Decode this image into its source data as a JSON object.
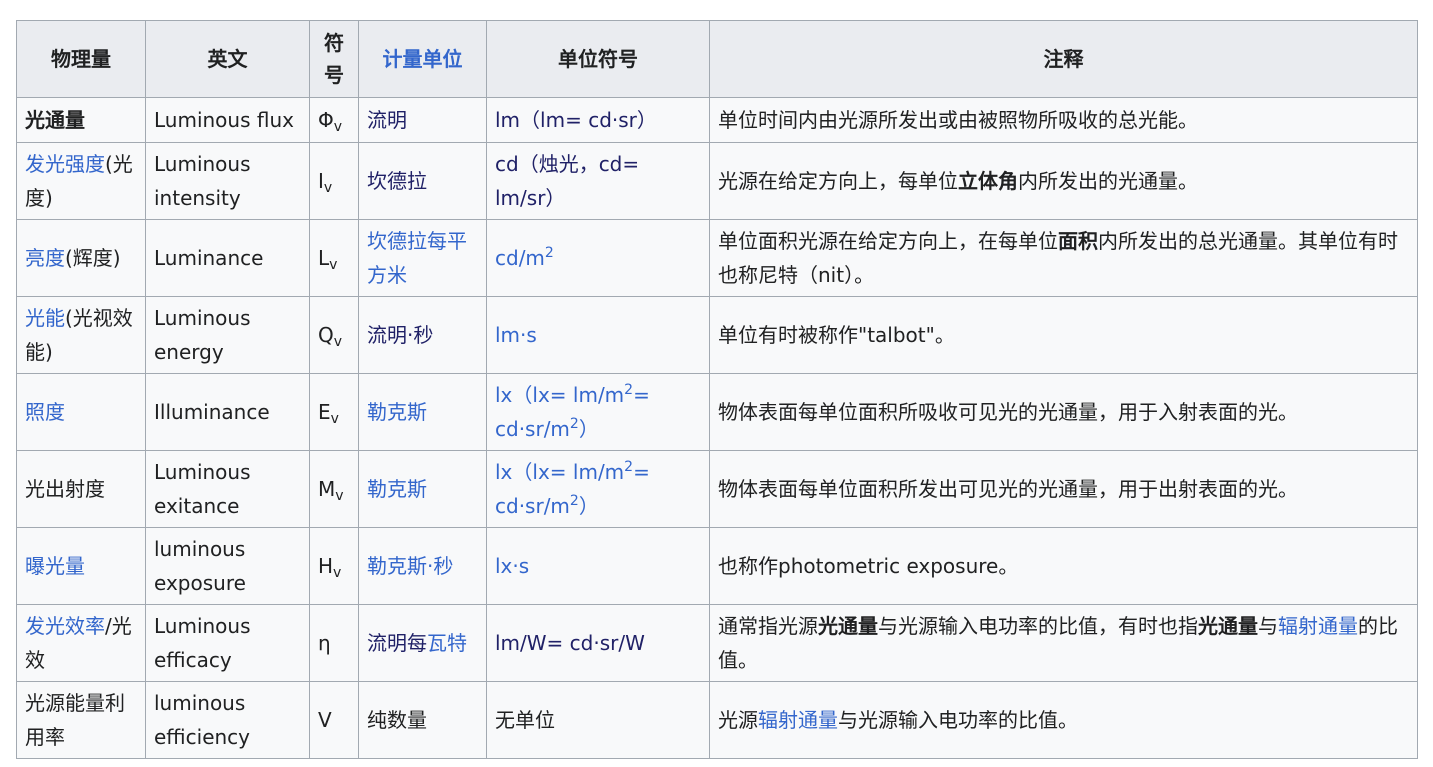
{
  "headers": {
    "quantity": "物理量",
    "english": "英文",
    "symbol": "符号",
    "unit": "计量单位",
    "unit_symbol": "单位符号",
    "notes": "注释"
  },
  "rows": [
    {
      "q": "光通量",
      "q_extra": "",
      "en": "Luminous flux",
      "sym": "Φ",
      "sub": "v",
      "unit_a": "流明",
      "unit_b": "",
      "us_a": "lm（lm= cd·sr）",
      "us_sup1": "",
      "us_b": "",
      "us_sup2": "",
      "us_c": "",
      "note_a": "单位时间内由光源所发出或由被照物所吸收的总光能。",
      "note_b": "",
      "note_c": "",
      "note_d": "",
      "note_e": "",
      "note_f": "",
      "note_g": ""
    },
    {
      "q": "发光强度",
      "q_extra": "(光度)",
      "en": "Luminous intensity",
      "sym": "I",
      "sub": "v",
      "unit_a": "坎德拉",
      "unit_b": "",
      "us_a": "cd（烛光，cd= lm/sr）",
      "us_sup1": "",
      "us_b": "",
      "us_sup2": "",
      "us_c": "",
      "note_a": "光源在给定方向上，每单位",
      "note_b": "立体角",
      "note_c": "内所发出的光通量。",
      "note_d": "",
      "note_e": "",
      "note_f": "",
      "note_g": ""
    },
    {
      "q": "亮度",
      "q_extra": "(辉度)",
      "en": "Luminance",
      "sym": "L",
      "sub": "v",
      "unit_a": "坎德拉每平方米",
      "unit_b": "",
      "us_a": "cd/m",
      "us_sup1": "2",
      "us_b": "",
      "us_sup2": "",
      "us_c": "",
      "note_a": "单位面积光源在给定方向上，在每单位",
      "note_b": "面积",
      "note_c": "内所发出的总光通量。其单位有时也称尼特（nit）。",
      "note_d": "",
      "note_e": "",
      "note_f": "",
      "note_g": ""
    },
    {
      "q": "光能",
      "q_extra": "(光视效能)",
      "en": "Luminous energy",
      "sym": "Q",
      "sub": "v",
      "unit_a": "流明·秒",
      "unit_b": "",
      "us_a": "lm·s",
      "us_sup1": "",
      "us_b": "",
      "us_sup2": "",
      "us_c": "",
      "note_a": "单位有时被称作\"talbot\"。",
      "note_b": "",
      "note_c": "",
      "note_d": "",
      "note_e": "",
      "note_f": "",
      "note_g": ""
    },
    {
      "q": "照度",
      "q_extra": "",
      "en": "Illuminance",
      "sym": "E",
      "sub": "v",
      "unit_a": "勒克斯",
      "unit_b": "",
      "us_a": "lx（lx= lm/m",
      "us_sup1": "2",
      "us_b": "= cd·sr/m",
      "us_sup2": "2",
      "us_c": "）",
      "note_a": "物体表面每单位面积所吸收可见光的光通量，用于入射表面的光。",
      "note_b": "",
      "note_c": "",
      "note_d": "",
      "note_e": "",
      "note_f": "",
      "note_g": ""
    },
    {
      "q": "光出射度",
      "q_extra": "",
      "en": "Luminous exitance",
      "sym": "M",
      "sub": "v",
      "unit_a": "勒克斯",
      "unit_b": "",
      "us_a": "lx（lx= lm/m",
      "us_sup1": "2",
      "us_b": "= cd·sr/m",
      "us_sup2": "2",
      "us_c": "）",
      "note_a": "物体表面每单位面积所发出可见光的光通量，用于出射表面的光。",
      "note_b": "",
      "note_c": "",
      "note_d": "",
      "note_e": "",
      "note_f": "",
      "note_g": ""
    },
    {
      "q": "曝光量",
      "q_extra": "",
      "en": "luminous exposure",
      "sym": "H",
      "sub": "v",
      "unit_a": "勒克斯·秒",
      "unit_b": "",
      "us_a": "lx·s",
      "us_sup1": "",
      "us_b": "",
      "us_sup2": "",
      "us_c": "",
      "note_a": "也称作photometric exposure。",
      "note_b": "",
      "note_c": "",
      "note_d": "",
      "note_e": "",
      "note_f": "",
      "note_g": ""
    },
    {
      "q": "发光效率",
      "q_extra": "/光效",
      "en": "Luminous efficacy",
      "sym": "η",
      "sub": "",
      "unit_a": "流明每",
      "unit_b": "瓦特",
      "us_a": "lm/W= cd·sr/W",
      "us_sup1": "",
      "us_b": "",
      "us_sup2": "",
      "us_c": "",
      "note_a": "通常指光源",
      "note_b": "光通量",
      "note_c": "与光源输入电功率的比值，有时也指",
      "note_d": "光通量",
      "note_e": "与",
      "note_f": "辐射通量",
      "note_g": "的比值。"
    },
    {
      "q": "光源能量利用率",
      "q_extra": "",
      "en": "luminous efficiency",
      "sym": "V",
      "sub": "",
      "unit_a": "纯数量",
      "unit_b": "",
      "us_a": "无单位",
      "us_sup1": "",
      "us_b": "",
      "us_sup2": "",
      "us_c": "",
      "note_a": "光源",
      "note_b": "辐射通量",
      "note_c": "与光源输入电功率的比值。",
      "note_d": "",
      "note_e": "",
      "note_f": "",
      "note_g": ""
    }
  ]
}
